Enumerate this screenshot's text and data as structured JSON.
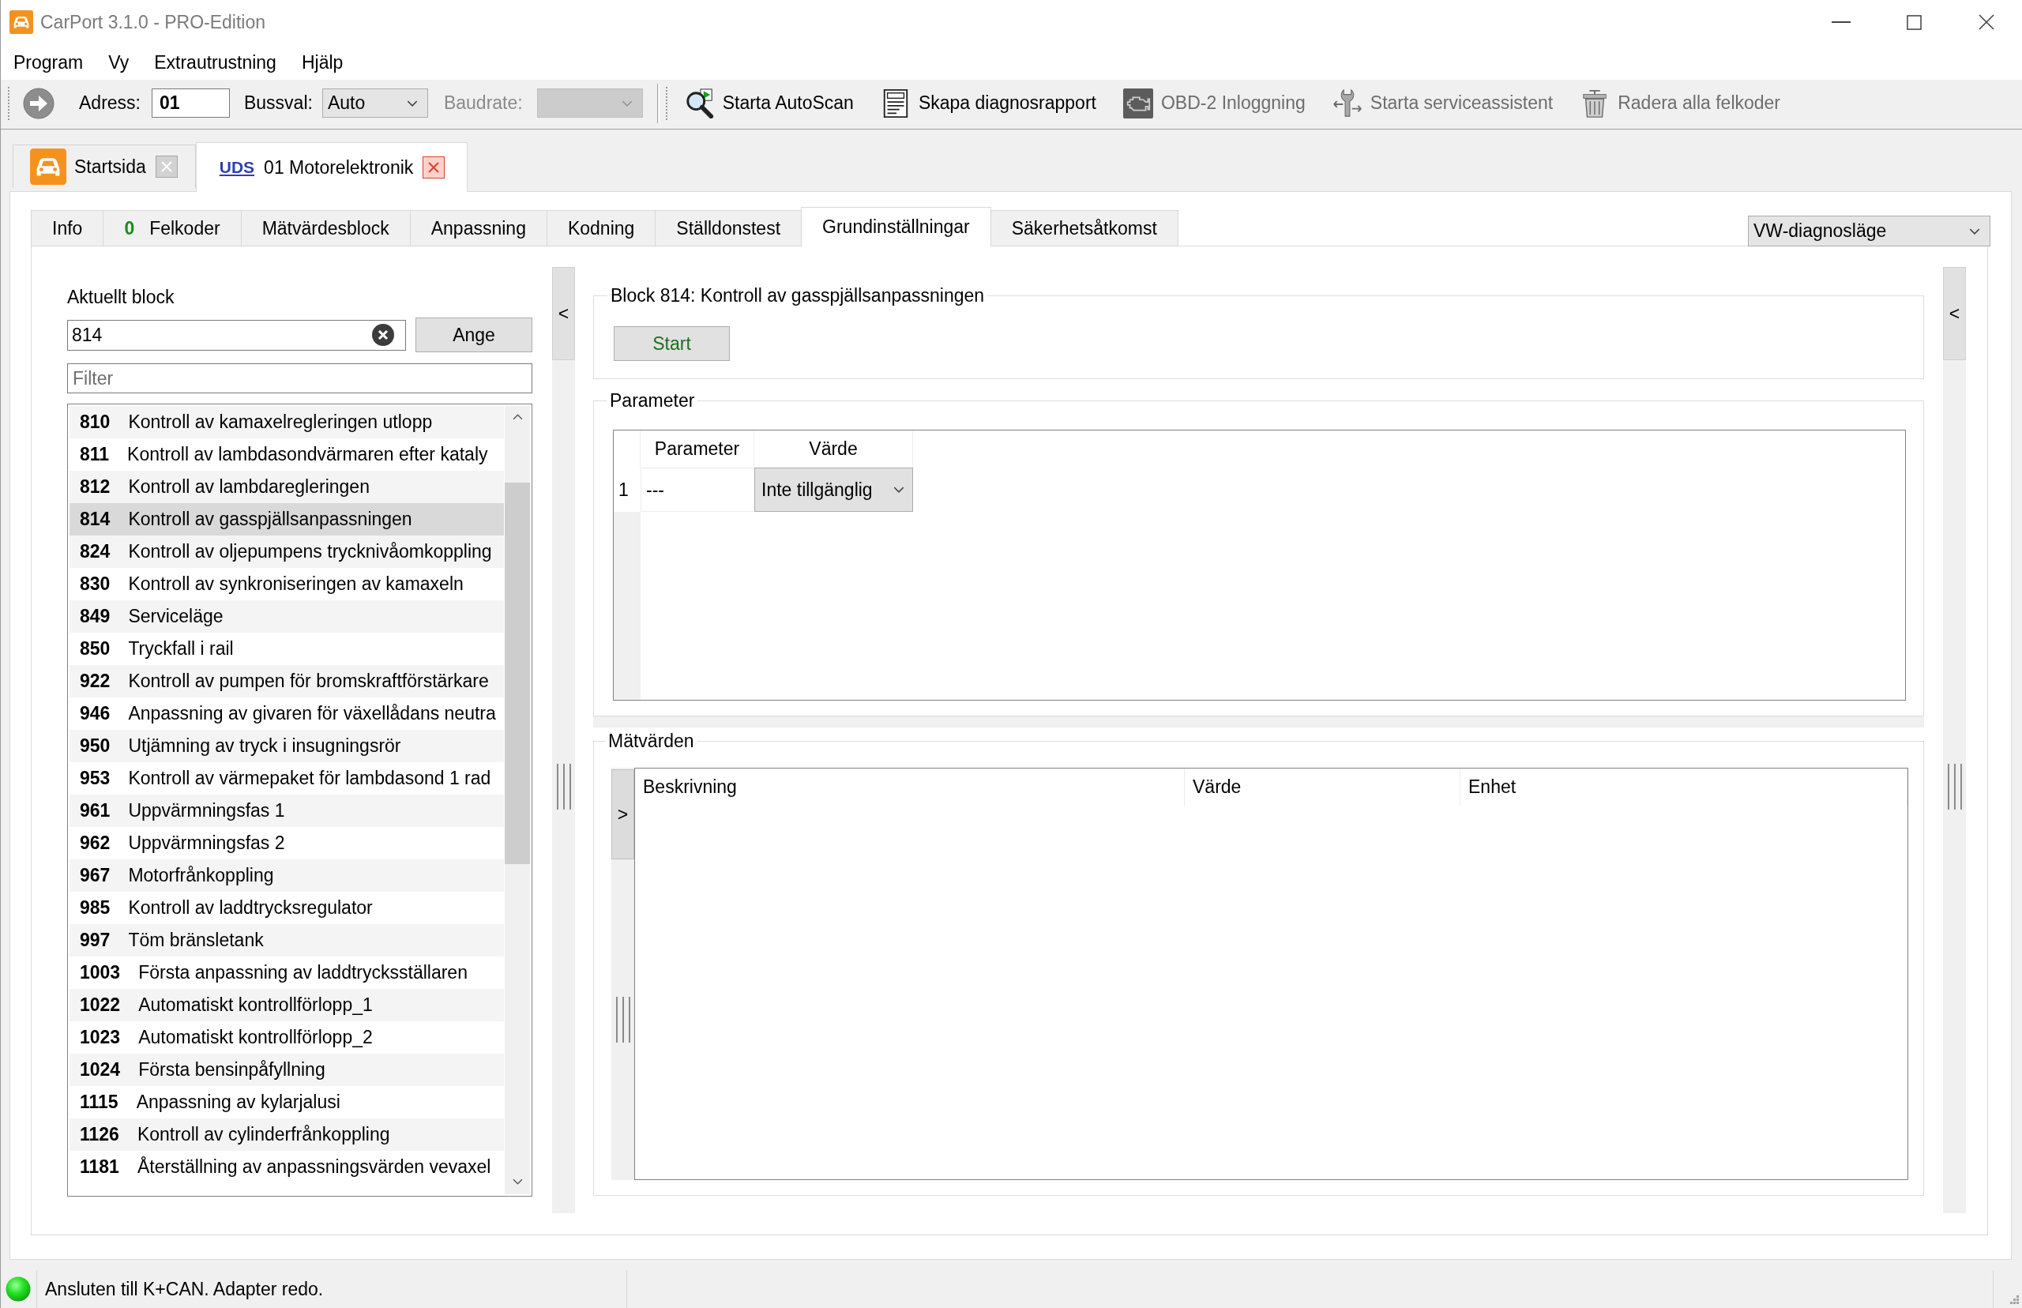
{
  "window": {
    "title": "CarPort 3.1.0 - PRO-Edition"
  },
  "menu": [
    {
      "label": "Program"
    },
    {
      "label": "Vy"
    },
    {
      "label": "Extrautrustning"
    },
    {
      "label": "Hjälp"
    }
  ],
  "toolbar": {
    "address": {
      "label": "Adress:",
      "value": "01"
    },
    "bus": {
      "label": "Bussval:",
      "value": "Auto"
    },
    "baudrate": {
      "label": "Baudrate:",
      "disabled": true
    },
    "actions": [
      {
        "kind": "autoscan",
        "label": "Starta AutoScan",
        "disabled": false
      },
      {
        "kind": "report",
        "label": "Skapa diagnosrapport",
        "disabled": false
      },
      {
        "kind": "obd",
        "label": "OBD-2 Inloggning",
        "disabled": true
      },
      {
        "kind": "service",
        "label": "Starta serviceassistent",
        "disabled": true
      },
      {
        "kind": "clear",
        "label": "Radera alla felkoder",
        "disabled": true
      }
    ]
  },
  "document_tabs": [
    {
      "kind": "home",
      "label": "Startsida",
      "selected": false
    },
    {
      "kind": "module",
      "protocol": "UDS",
      "label": "01 Motorelektronik",
      "selected": true
    }
  ],
  "function_tabs": [
    {
      "label": "Info",
      "selected": false
    },
    {
      "count": "0",
      "label": "Felkoder",
      "selected": false
    },
    {
      "label": "Mätvärdesblock",
      "selected": false
    },
    {
      "label": "Anpassning",
      "selected": false
    },
    {
      "label": "Kodning",
      "selected": false
    },
    {
      "label": "Ställdonstest",
      "selected": false
    },
    {
      "label": "Grundinställningar",
      "selected": true
    },
    {
      "label": "Säkerhetsåtkomst",
      "selected": false
    }
  ],
  "mode_select": {
    "value": "VW-diagnosläge"
  },
  "block_panel": {
    "label": "Aktuellt block",
    "value": "814",
    "apply_button": "Ange",
    "filter_placeholder": "Filter",
    "blocks": [
      {
        "number": "810",
        "name": "Kontroll av kamaxelregleringen utlopp",
        "selected": false
      },
      {
        "number": "811",
        "name": "Kontroll av lambdasondvärmaren efter kataly",
        "selected": false
      },
      {
        "number": "812",
        "name": "Kontroll av lambdaregleringen",
        "selected": false
      },
      {
        "number": "814",
        "name": "Kontroll av gasspjällsanpassningen",
        "selected": true
      },
      {
        "number": "824",
        "name": "Kontroll av oljepumpens trycknivåomkoppling",
        "selected": false
      },
      {
        "number": "830",
        "name": "Kontroll av synkroniseringen av kamaxeln",
        "selected": false
      },
      {
        "number": "849",
        "name": "Serviceläge",
        "selected": false
      },
      {
        "number": "850",
        "name": "Tryckfall i rail",
        "selected": false
      },
      {
        "number": "922",
        "name": "Kontroll av pumpen för bromskraftförstärkare",
        "selected": false
      },
      {
        "number": "946",
        "name": "Anpassning av givaren för växellådans neutra",
        "selected": false
      },
      {
        "number": "950",
        "name": "Utjämning av tryck i insugningsrör",
        "selected": false
      },
      {
        "number": "953",
        "name": "Kontroll av värmepaket för lambdasond 1 rad",
        "selected": false
      },
      {
        "number": "961",
        "name": "Uppvärmningsfas 1",
        "selected": false
      },
      {
        "number": "962",
        "name": "Uppvärmningsfas 2",
        "selected": false
      },
      {
        "number": "967",
        "name": "Motorfrånkoppling",
        "selected": false
      },
      {
        "number": "985",
        "name": "Kontroll av laddtrycksregulator",
        "selected": false
      },
      {
        "number": "997",
        "name": "Töm bränsletank",
        "selected": false
      },
      {
        "number": "1003",
        "name": "Första anpassning av laddtrycksställaren",
        "selected": false
      },
      {
        "number": "1022",
        "name": "Automatiskt kontrollförlopp_1",
        "selected": false
      },
      {
        "number": "1023",
        "name": "Automatiskt kontrollförlopp_2",
        "selected": false
      },
      {
        "number": "1024",
        "name": "Första bensinpåfyllning",
        "selected": false
      },
      {
        "number": "1115",
        "name": "Anpassning av kylarjalusi",
        "selected": false
      },
      {
        "number": "1126",
        "name": "Kontroll av cylinderfrånkoppling",
        "selected": false
      },
      {
        "number": "1181",
        "name": "Återställning av anpassningsvärden vevaxel",
        "selected": false
      }
    ]
  },
  "left_splitter": {
    "toggle": "<"
  },
  "block_group": {
    "title": "Block 814: Kontroll av gasspjällsanpassningen",
    "start_button": "Start"
  },
  "parameter_group": {
    "title": "Parameter",
    "columns": [
      "Parameter",
      "Värde"
    ],
    "rows": [
      {
        "number": "1",
        "parameter": "---",
        "value": "Inte tillgänglig"
      }
    ]
  },
  "measurements_group": {
    "title": "Mätvärden",
    "toggle": ">",
    "columns": [
      "Beskrivning",
      "Värde",
      "Enhet"
    ]
  },
  "right_splitter": {
    "toggle": "<"
  },
  "status_bar": {
    "connected": true,
    "text": "Ansluten till K+CAN. Adapter redo."
  }
}
